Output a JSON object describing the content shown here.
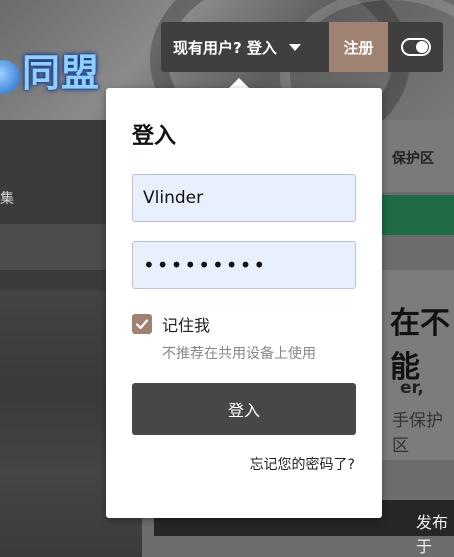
{
  "header": {
    "login_label": "现有用户? 登入",
    "register_label": "注册",
    "theme_toggle": "toggle-icon"
  },
  "logo": {
    "text": "同盟"
  },
  "sidebar": {
    "partial_label": "集"
  },
  "main": {
    "breadcrumb_text": "保护区",
    "card_title_partial": "在不能",
    "card_author_partial": "er,",
    "card_sub_partial": "手保护区",
    "post_label": "发布于"
  },
  "login_popup": {
    "title": "登入",
    "username_value": "Vlinder",
    "password_value": "•••••••••",
    "remember_label": "记住我",
    "remember_checked": true,
    "remember_note": "不推荐在共用设备上使用",
    "submit_label": "登入",
    "forgot_label": "忘记您的密码了?"
  },
  "colors": {
    "accent": "#a08273",
    "button_dark": "#474747",
    "field_bg": "#e8f0fe"
  }
}
